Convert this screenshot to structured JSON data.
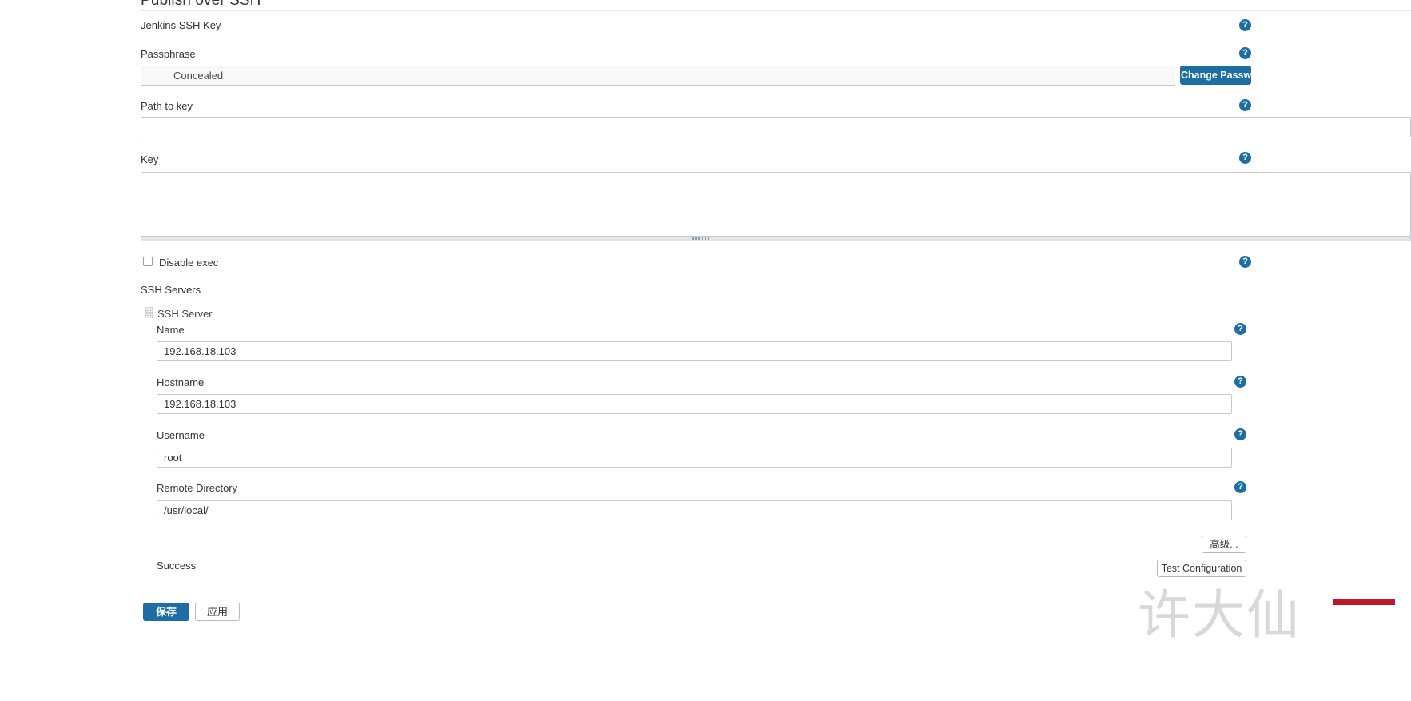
{
  "section": {
    "title": "Publish over SSH"
  },
  "fields": {
    "jenkins_ssh_key_label": "Jenkins SSH Key",
    "passphrase_label": "Passphrase",
    "passphrase_value": "Concealed",
    "change_password_button": "Change Password",
    "path_to_key_label": "Path to key",
    "path_to_key_value": "",
    "key_label": "Key",
    "key_value": "",
    "disable_exec_label": "Disable exec",
    "disable_exec_checked": false
  },
  "ssh_servers": {
    "section_label": "SSH Servers",
    "entry_label": "SSH Server",
    "name_label": "Name",
    "name_value": "192.168.18.103",
    "hostname_label": "Hostname",
    "hostname_value": "192.168.18.103",
    "username_label": "Username",
    "username_value": "root",
    "remote_directory_label": "Remote Directory",
    "remote_directory_value": "/usr/local/",
    "advanced_button": "高级...",
    "test_configuration_button": "Test Configuration",
    "test_result": "Success"
  },
  "footer": {
    "save_button": "保存",
    "apply_button": "应用"
  },
  "watermark": {
    "text": "许大仙"
  },
  "icons": {
    "help": "?",
    "lock": "lock-icon",
    "drag_handle": "drag-handle-icon"
  },
  "colors": {
    "accent": "#1c6ea4",
    "border": "#c8c8c8",
    "watermark_red": "#c0182b"
  }
}
